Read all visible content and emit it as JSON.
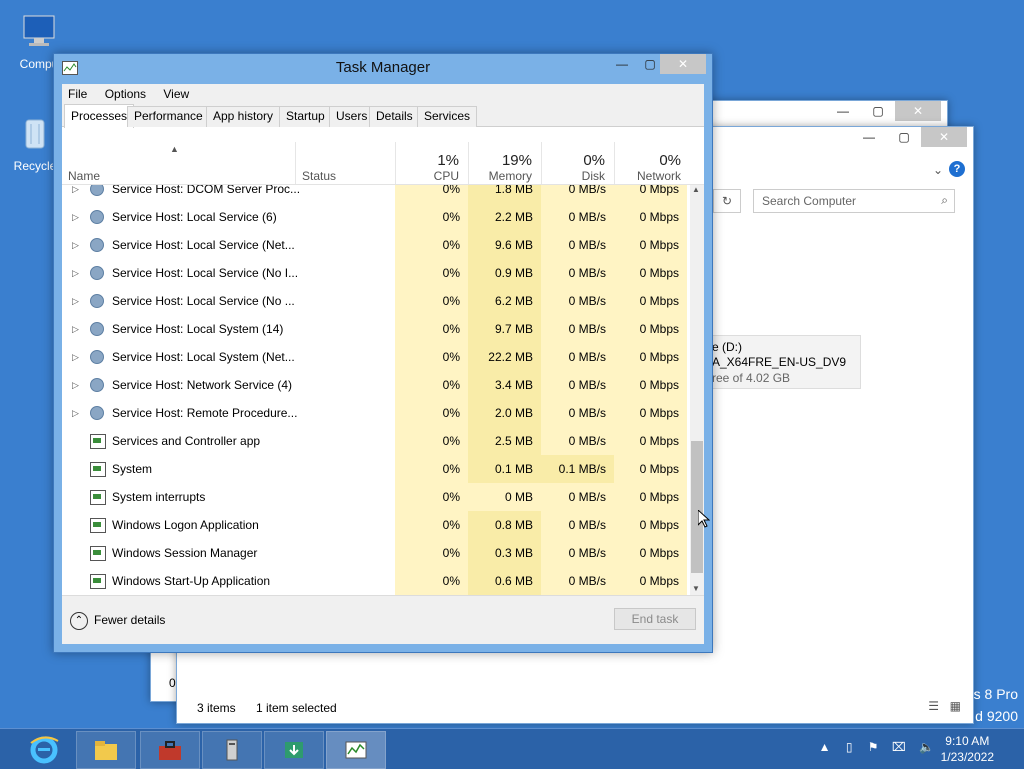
{
  "desktop": {
    "icons": [
      {
        "label": "Compu"
      },
      {
        "label": "Recycle"
      }
    ],
    "watermark_line1": "s 8 Pro",
    "watermark_line2": "d 9200"
  },
  "explorer": {
    "search_placeholder": "Search Computer",
    "drive_line1": "e (D:)",
    "drive_line2": "A_X64FRE_EN-US_DV9",
    "drive_line3": "ree of 4.02 GB",
    "status_items": "3 items",
    "status_selected": "1 item selected",
    "partial": "0"
  },
  "taskmanager": {
    "title": "Task Manager",
    "menu": [
      "File",
      "Options",
      "View"
    ],
    "tabs": [
      "Processes",
      "Performance",
      "App history",
      "Startup",
      "Users",
      "Details",
      "Services"
    ],
    "columns": {
      "name": "Name",
      "status": "Status",
      "cpu_pct": "1%",
      "cpu": "CPU",
      "mem_pct": "19%",
      "mem": "Memory",
      "disk_pct": "0%",
      "disk": "Disk",
      "net_pct": "0%",
      "net": "Network"
    },
    "rows": [
      {
        "name": "Service Host: DCOM Server Proc...",
        "cpu": "0%",
        "mem": "1.8 MB",
        "disk": "0 MB/s",
        "net": "0 Mbps",
        "icon": "gear",
        "expandable": true
      },
      {
        "name": "Service Host: Local Service (6)",
        "cpu": "0%",
        "mem": "2.2 MB",
        "disk": "0 MB/s",
        "net": "0 Mbps",
        "icon": "gear",
        "expandable": true
      },
      {
        "name": "Service Host: Local Service (Net...",
        "cpu": "0%",
        "mem": "9.6 MB",
        "disk": "0 MB/s",
        "net": "0 Mbps",
        "icon": "gear",
        "expandable": true
      },
      {
        "name": "Service Host: Local Service (No I...",
        "cpu": "0%",
        "mem": "0.9 MB",
        "disk": "0 MB/s",
        "net": "0 Mbps",
        "icon": "gear",
        "expandable": true
      },
      {
        "name": "Service Host: Local Service (No ...",
        "cpu": "0%",
        "mem": "6.2 MB",
        "disk": "0 MB/s",
        "net": "0 Mbps",
        "icon": "gear",
        "expandable": true
      },
      {
        "name": "Service Host: Local System (14)",
        "cpu": "0%",
        "mem": "9.7 MB",
        "disk": "0 MB/s",
        "net": "0 Mbps",
        "icon": "gear",
        "expandable": true
      },
      {
        "name": "Service Host: Local System (Net...",
        "cpu": "0%",
        "mem": "22.2 MB",
        "disk": "0 MB/s",
        "net": "0 Mbps",
        "icon": "gear",
        "expandable": true
      },
      {
        "name": "Service Host: Network Service (4)",
        "cpu": "0%",
        "mem": "3.4 MB",
        "disk": "0 MB/s",
        "net": "0 Mbps",
        "icon": "gear",
        "expandable": true
      },
      {
        "name": "Service Host: Remote Procedure...",
        "cpu": "0%",
        "mem": "2.0 MB",
        "disk": "0 MB/s",
        "net": "0 Mbps",
        "icon": "gear",
        "expandable": true
      },
      {
        "name": "Services and Controller app",
        "cpu": "0%",
        "mem": "2.5 MB",
        "disk": "0 MB/s",
        "net": "0 Mbps",
        "icon": "app",
        "expandable": false
      },
      {
        "name": "System",
        "cpu": "0%",
        "mem": "0.1 MB",
        "disk": "0.1 MB/s",
        "net": "0 Mbps",
        "icon": "app",
        "expandable": false
      },
      {
        "name": "System interrupts",
        "cpu": "0%",
        "mem": "0 MB",
        "disk": "0 MB/s",
        "net": "0 Mbps",
        "icon": "app",
        "expandable": false
      },
      {
        "name": "Windows Logon Application",
        "cpu": "0%",
        "mem": "0.8 MB",
        "disk": "0 MB/s",
        "net": "0 Mbps",
        "icon": "app",
        "expandable": false
      },
      {
        "name": "Windows Session Manager",
        "cpu": "0%",
        "mem": "0.3 MB",
        "disk": "0 MB/s",
        "net": "0 Mbps",
        "icon": "app",
        "expandable": false
      },
      {
        "name": "Windows Start-Up Application",
        "cpu": "0%",
        "mem": "0.6 MB",
        "disk": "0 MB/s",
        "net": "0 Mbps",
        "icon": "app",
        "expandable": false
      }
    ],
    "fewer_details": "Fewer details",
    "end_task": "End task"
  },
  "taskbar": {
    "time": "9:10 AM",
    "date": "1/23/2022",
    "apps": [
      "internet-explorer-icon",
      "file-explorer-icon",
      "toolbox-icon",
      "server-manager-icon",
      "download-icon",
      "task-manager-icon"
    ]
  },
  "colors": {
    "heat_light": "#fff4c4",
    "heat_medium": "#f9eca8",
    "heat_strong": "#f4df8a"
  }
}
